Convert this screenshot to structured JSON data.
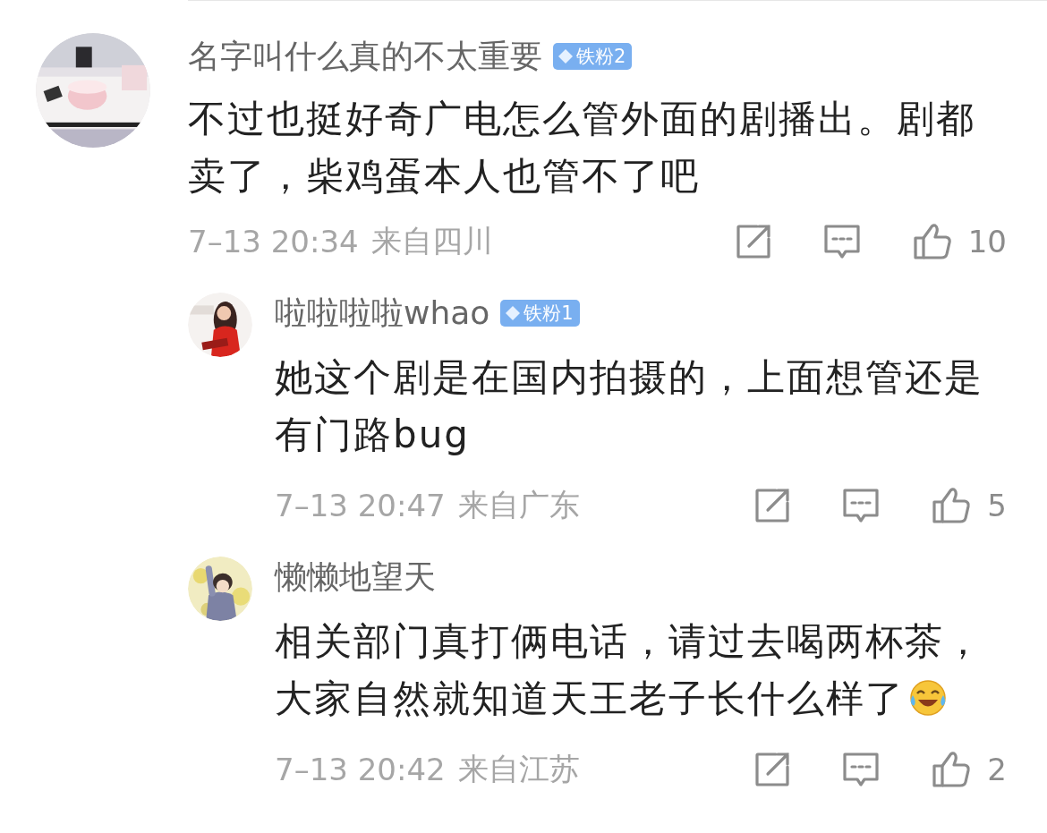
{
  "comments": [
    {
      "author": "名字叫什么真的不太重要",
      "badge": "铁粉2",
      "text": "不过也挺好奇广电怎么管外面的剧播出。剧都卖了，柴鸡蛋本人也管不了吧",
      "time": "7–13 20:34",
      "location": "来自四川",
      "likes": "10",
      "replies": [
        {
          "author": "啦啦啦啦whao",
          "badge": "铁粉1",
          "text": "她这个剧是在国内拍摄的，上面想管还是有门路bug",
          "time": "7–13 20:47",
          "location": "来自广东",
          "likes": "5",
          "trailing_emoji": false
        },
        {
          "author": "懒懒地望天",
          "text": "相关部门真打俩电话，请过去喝两杯茶，大家自然就知道天王老子长什么样了",
          "time": "7–13 20:42",
          "location": "来自江苏",
          "likes": "2",
          "trailing_emoji": true
        }
      ]
    }
  ]
}
